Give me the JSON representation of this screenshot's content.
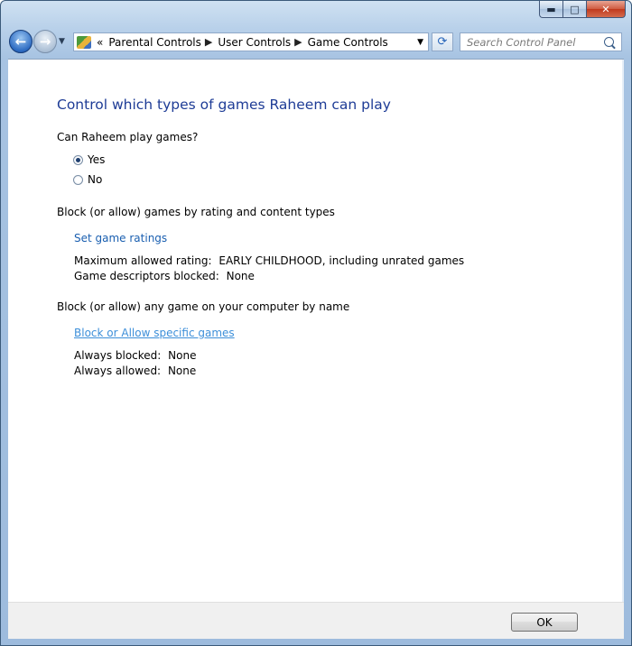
{
  "window": {
    "caption": {
      "minimize": "▬",
      "maximize": "□",
      "close": "✕"
    }
  },
  "toolbar": {
    "back_icon": "←",
    "forward_icon": "→",
    "address_overflow": "«",
    "breadcrumbs": [
      "Parental Controls",
      "User Controls",
      "Game Controls"
    ],
    "refresh_icon": "⟳",
    "search_placeholder": "Search Control Panel"
  },
  "main": {
    "title": "Control which types of games Raheem can play",
    "question": "Can Raheem play games?",
    "options": [
      {
        "label": "Yes",
        "checked": true
      },
      {
        "label": "No",
        "checked": false
      }
    ],
    "ratings_section": {
      "heading": "Block (or allow) games by rating and content types",
      "link": "Set game ratings",
      "max_rating_label": "Maximum allowed rating:",
      "max_rating_value": "EARLY CHILDHOOD, including unrated games",
      "descriptors_label": "Game descriptors blocked:",
      "descriptors_value": "None"
    },
    "games_section": {
      "heading": "Block (or allow) any game on your computer by name",
      "link": "Block or Allow specific games",
      "blocked_label": "Always blocked:",
      "blocked_value": "None",
      "allowed_label": "Always allowed:",
      "allowed_value": "None"
    }
  },
  "footer": {
    "ok_label": "OK"
  }
}
